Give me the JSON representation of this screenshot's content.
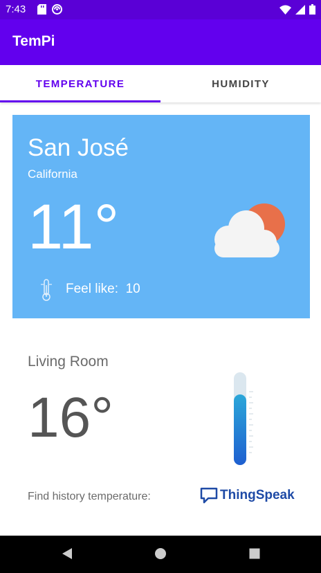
{
  "status_bar": {
    "time": "7:43"
  },
  "app": {
    "title": "TemPi"
  },
  "tabs": [
    {
      "label": "TEMPERATURE"
    },
    {
      "label": "HUMIDITY"
    }
  ],
  "weather": {
    "city": "San José",
    "region": "California",
    "temperature": "11°",
    "feel_like_label": "Feel like:",
    "feel_like_value": "10",
    "icon": "partly-cloudy-icon"
  },
  "room": {
    "name": "Living Room",
    "temperature": "16°",
    "history_label": "Find history temperature:",
    "history_link": "ThingSpeak"
  },
  "colors": {
    "primary": "#6200ee",
    "status_bar": "#5a00d6",
    "card": "#64b5f6",
    "sun": "#e8704a"
  }
}
